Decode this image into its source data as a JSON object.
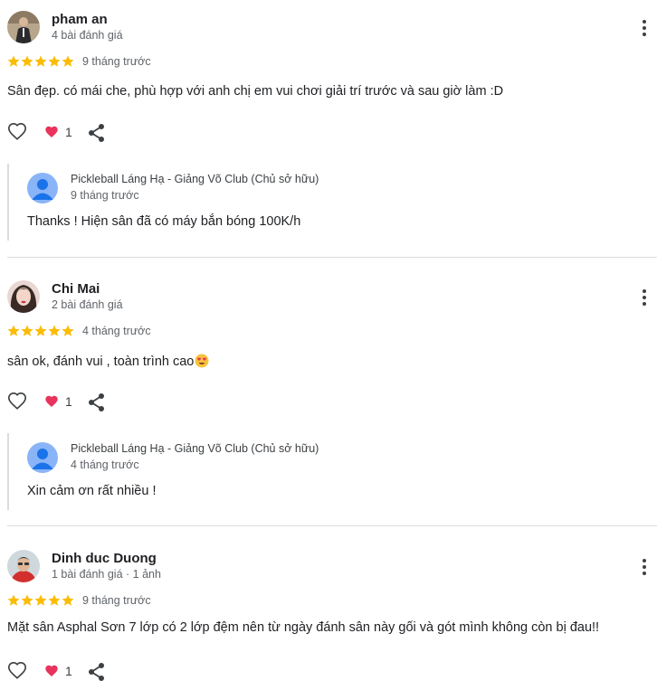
{
  "reviews": [
    {
      "name": "pham an",
      "meta": "4 bài đánh giá",
      "rating": 5,
      "when": "9 tháng trước",
      "text": "Sân đẹp. có mái che, phù hợp với anh chị em vui chơi giải trí trước và sau giờ làm :D",
      "likes": "1",
      "reply": {
        "owner": "Pickleball Láng Hạ - Giảng Võ Club (Chủ sở hữu)",
        "when": "9 tháng trước",
        "text": "Thanks ! Hiện sân đã có máy bắn bóng 100K/h"
      }
    },
    {
      "name": "Chi Mai",
      "meta": "2 bài đánh giá",
      "rating": 5,
      "when": "4 tháng trước",
      "text": "sân ok, đánh vui , toàn trình cao",
      "likes": "1",
      "reply": {
        "owner": "Pickleball Láng Hạ - Giảng Võ Club (Chủ sở hữu)",
        "when": "4 tháng trước",
        "text": "Xin cảm ơn rất nhiều !"
      }
    },
    {
      "name": "Dinh duc Duong",
      "meta": "1 bài đánh giá · 1 ảnh",
      "rating": 5,
      "when": "9 tháng trước",
      "text": "Mặt sân Asphal Sơn 7 lớp có 2 lớp đệm nên từ ngày đánh sân này gối và gót mình không còn bị đau!!",
      "likes": "1"
    }
  ],
  "colors": {
    "star": "#fbbc04",
    "heart": "#e8335c",
    "divider": "#dadce0",
    "owner_avatar": "#8ab4f8"
  }
}
